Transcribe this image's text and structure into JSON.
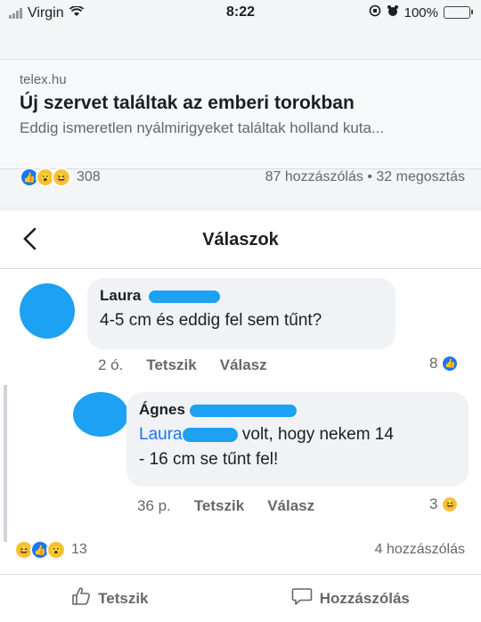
{
  "status_bar": {
    "carrier": "Virgin",
    "time": "8:22",
    "battery": "100%"
  },
  "link_preview": {
    "domain": "telex.hu",
    "title": "Új szervet találtak az emberi torokban",
    "description": "Eddig ismeretlen nyálmirigyeket találtak holland kuta..."
  },
  "post_stats": {
    "reactions": "308",
    "comments": "87 hozzászólás",
    "shares": "32 megosztás",
    "separator": "•"
  },
  "replies_panel": {
    "title": "Válaszok"
  },
  "comment": {
    "author": "Laura",
    "text": "4-5 cm és eddig fel sem tűnt?",
    "time": "2 ó.",
    "like_label": "Tetszik",
    "reply_label": "Válasz",
    "reaction_count": "8"
  },
  "reply": {
    "author": "Ágnes",
    "mention": "Laura",
    "text_after_mention": " volt, hogy nekem 14",
    "text_line2": "- 16 cm se tűnt fel!",
    "time": "36 p.",
    "like_label": "Tetszik",
    "reply_label": "Válasz",
    "reaction_count": "3"
  },
  "footer": {
    "reactions": "13",
    "comments": "4 hozzászólás",
    "like_button": "Tetszik",
    "comment_button": "Hozzászólás"
  },
  "colors": {
    "accent": "#1877f2",
    "redaction": "#1da1f2"
  }
}
